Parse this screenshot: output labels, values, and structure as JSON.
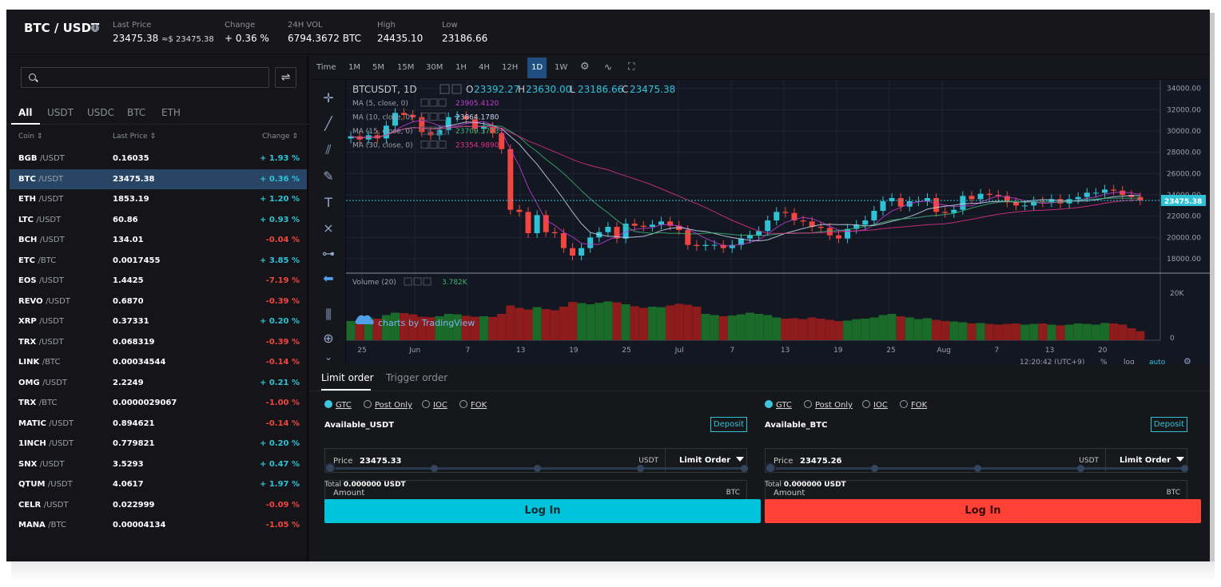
{
  "header": {
    "pair": "BTC / USDT",
    "stats": [
      {
        "label": "Last Price",
        "value": "23475.38",
        "sub": "≈$ 23475.38"
      },
      {
        "label": "Change",
        "value": "+ 0.36 %"
      },
      {
        "label": "24H VOL",
        "value": "6794.3672 BTC"
      },
      {
        "label": "High",
        "value": "24435.10"
      },
      {
        "label": "Low",
        "value": "23186.66"
      }
    ]
  },
  "market": {
    "swap_icon": "⇌",
    "tabs": [
      "All",
      "USDT",
      "USDC",
      "BTC",
      "ETH"
    ],
    "columns": [
      "Coin",
      "Last Price",
      "Change"
    ],
    "rows": [
      {
        "coin": "BGB",
        "quote": "/USDT",
        "price": "0.16035",
        "change": "+ 1.93 %",
        "up": true
      },
      {
        "coin": "BTC",
        "quote": "/USDT",
        "price": "23475.38",
        "change": "+ 0.36 %",
        "up": true
      },
      {
        "coin": "ETH",
        "quote": "/USDT",
        "price": "1853.19",
        "change": "+ 1.20 %",
        "up": true
      },
      {
        "coin": "LTC",
        "quote": "/USDT",
        "price": "60.86",
        "change": "+ 0.93 %",
        "up": true
      },
      {
        "coin": "BCH",
        "quote": "/USDT",
        "price": "134.01",
        "change": "-0.04 %",
        "up": false
      },
      {
        "coin": "ETC",
        "quote": "/BTC",
        "price": "0.0017455",
        "change": "+ 3.85 %",
        "up": true
      },
      {
        "coin": "EOS",
        "quote": "/USDT",
        "price": "1.4425",
        "change": "-7.19 %",
        "up": false
      },
      {
        "coin": "REVO",
        "quote": "/USDT",
        "price": "0.6870",
        "change": "-0.39 %",
        "up": false
      },
      {
        "coin": "XRP",
        "quote": "/USDT",
        "price": "0.37331",
        "change": "+ 0.20 %",
        "up": true
      },
      {
        "coin": "TRX",
        "quote": "/USDT",
        "price": "0.068319",
        "change": "-0.39 %",
        "up": false
      },
      {
        "coin": "LINK",
        "quote": "/BTC",
        "price": "0.00034544",
        "change": "-0.14 %",
        "up": false
      },
      {
        "coin": "OMG",
        "quote": "/USDT",
        "price": "2.2249",
        "change": "+ 0.21 %",
        "up": true
      },
      {
        "coin": "TRX",
        "quote": "/BTC",
        "price": "0.0000029067",
        "change": "-1.00 %",
        "up": false
      },
      {
        "coin": "MATIC",
        "quote": "/USDT",
        "price": "0.894621",
        "change": "-0.14 %",
        "up": false
      },
      {
        "coin": "1INCH",
        "quote": "/USDT",
        "price": "0.779821",
        "change": "+ 0.20 %",
        "up": true
      },
      {
        "coin": "SNX",
        "quote": "/USDT",
        "price": "3.5293",
        "change": "+ 0.47 %",
        "up": true
      },
      {
        "coin": "QTUM",
        "quote": "/USDT",
        "price": "4.0617",
        "change": "+ 1.97 %",
        "up": true
      },
      {
        "coin": "CELR",
        "quote": "/USDT",
        "price": "0.022999",
        "change": "-0.09 %",
        "up": false
      },
      {
        "coin": "MANA",
        "quote": "/BTC",
        "price": "0.00004134",
        "change": "-1.05 %",
        "up": false
      }
    ]
  },
  "toolbar": {
    "intervals": [
      "Time",
      "1M",
      "5M",
      "15M",
      "30M",
      "1H",
      "4H",
      "12H",
      "1D",
      "1W"
    ],
    "active_interval": "1D",
    "icons": [
      "gear-icon",
      "indicators-icon",
      "fullscreen-icon"
    ]
  },
  "chart_data": {
    "type": "candlestick",
    "symbol": "BTCUSDT, 1D",
    "ohlc_legend": {
      "O": "23392.27",
      "H": "23630.00",
      "L": "23186.66",
      "C": "23475.38"
    },
    "indicators": [
      {
        "name": "MA (5, close, 0)",
        "value": "23905.4120",
        "color": "#c33cd6"
      },
      {
        "name": "MA (10, close, 0)",
        "value": "23864.1780",
        "color": "#c8d6f0"
      },
      {
        "name": "MA (15, close, 0)",
        "value": "23709.3773",
        "color": "#3cb371"
      },
      {
        "name": "MA (30, close, 0)",
        "value": "23354.9890",
        "color": "#e0308a"
      }
    ],
    "volume_label": "Volume (20)",
    "volume_value": "3.782K",
    "watermark": "charts by TradingView",
    "price_ticks": [
      "34000.00",
      "32000.00",
      "30000.00",
      "28000.00",
      "26000.00",
      "24000.00",
      "22000.00",
      "20000.00",
      "18000.00"
    ],
    "volume_ticks": [
      "20K",
      "0"
    ],
    "x_ticks": [
      "25",
      "Jun",
      "7",
      "13",
      "19",
      "25",
      "Jul",
      "7",
      "13",
      "19",
      "25",
      "Aug",
      "7",
      "13",
      "20"
    ],
    "last_price_label": "23475.38",
    "ylim": [
      16800,
      34800
    ],
    "closes": [
      29500,
      29200,
      29600,
      29300,
      30500,
      31700,
      31500,
      31300,
      29900,
      29600,
      30100,
      31300,
      31400,
      31100,
      30200,
      30400,
      29800,
      28300,
      22600,
      22400,
      20400,
      22100,
      20500,
      20400,
      19000,
      18300,
      19000,
      20000,
      20500,
      21000,
      19900,
      21300,
      21100,
      21000,
      21200,
      21500,
      21100,
      20700,
      19300,
      19200,
      19300,
      19300,
      19000,
      19300,
      19900,
      20200,
      20600,
      21600,
      22400,
      22300,
      21600,
      21500,
      21000,
      20900,
      20200,
      19900,
      20800,
      21200,
      21600,
      22500,
      23400,
      23700,
      22900,
      23400,
      23400,
      23700,
      22400,
      22300,
      22600,
      23900,
      23600,
      24100,
      24000,
      23900,
      23300,
      23000,
      23000,
      23400,
      23300,
      23600,
      23200,
      23600,
      23800,
      24200,
      24200,
      24500,
      24400,
      24000,
      23800,
      23475
    ],
    "volumes": [
      8000,
      8200,
      9500,
      9000,
      10500,
      11500,
      11300,
      10800,
      9800,
      9600,
      10000,
      11000,
      10800,
      10200,
      9800,
      10000,
      9700,
      11000,
      14500,
      13500,
      12800,
      13800,
      13000,
      12500,
      14000,
      16000,
      15500,
      15000,
      15600,
      16200,
      15800,
      15000,
      14200,
      13500,
      14000,
      13800,
      14500,
      15200,
      14800,
      14000,
      11000,
      10500,
      10000,
      10300,
      10800,
      11500,
      11000,
      10500,
      9500,
      9000,
      9200,
      8800,
      9500,
      9000,
      8500,
      8000,
      8200,
      8800,
      9000,
      9500,
      10500,
      11000,
      10000,
      9500,
      8800,
      9200,
      8500,
      8000,
      7800,
      7500,
      7000,
      7200,
      6800,
      6500,
      6800,
      7000,
      6500,
      6800,
      7000,
      6500,
      6200,
      6500,
      7000,
      6800,
      6500,
      7200,
      7000,
      6500,
      5000,
      3782
    ],
    "status": {
      "time": "12:20:42 (UTC+9)",
      "percent": "%",
      "log": "log",
      "auto": "auto"
    }
  },
  "colors": {
    "up": "#2fc2d6",
    "down": "#f0463f",
    "accent": "#2fc2d6",
    "buy": "#00c4dc",
    "sell": "#ff4136"
  },
  "order": {
    "tabs": [
      "Limit order",
      "Trigger order"
    ],
    "buy": {
      "options": [
        "GTC",
        "Post Only",
        "IOC",
        "FOK"
      ],
      "available": "Available_USDT",
      "deposit": "Deposit",
      "price_label": "Price",
      "price": "23475.33",
      "price_unit": "USDT",
      "type": "Limit Order",
      "amount_label": "Amount",
      "amount_unit": "BTC",
      "total_label": "Total",
      "total": "0.000000 USDT",
      "login": "Log In"
    },
    "sell": {
      "options": [
        "GTC",
        "Post Only",
        "IOC",
        "FOK"
      ],
      "available": "Available_BTC",
      "deposit": "Deposit",
      "price_label": "Price",
      "price": "23475.26",
      "price_unit": "USDT",
      "type": "Limit Order",
      "amount_label": "Amount",
      "amount_unit": "BTC",
      "total_label": "Total",
      "total": "0.000000 USDT",
      "login": "Log In"
    }
  }
}
